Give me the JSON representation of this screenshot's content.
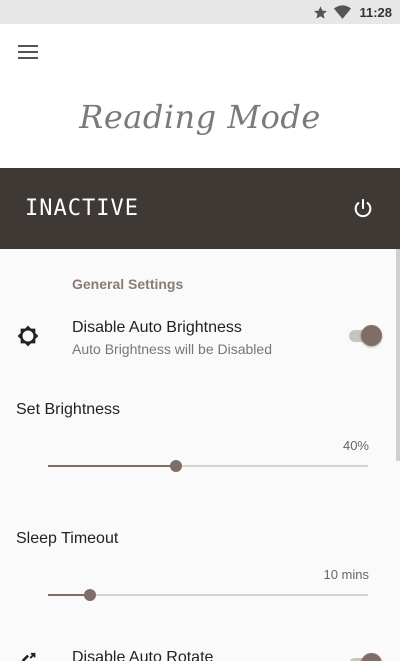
{
  "status_bar": {
    "time": "11:28",
    "icons": [
      "star-icon",
      "wifi-icon"
    ]
  },
  "app": {
    "logo_text": "Reading Mode"
  },
  "banner": {
    "status": "INACTIVE",
    "power_icon": "power-icon"
  },
  "settings": {
    "section_header": "General Settings",
    "auto_brightness": {
      "title": "Disable Auto Brightness",
      "subtitle": "Auto Brightness will be Disabled",
      "enabled": true
    },
    "brightness": {
      "label": "Set Brightness",
      "value_text": "40%",
      "level": 0.4
    },
    "sleep_timeout": {
      "label": "Sleep Timeout",
      "value_text": "10 mins",
      "level": 0.13
    },
    "auto_rotate": {
      "title": "Disable Auto Rotate",
      "enabled": true
    }
  },
  "colors": {
    "accent": "#7f6d66",
    "banner_bg": "#3e3934",
    "section_header": "#8c7b74"
  }
}
